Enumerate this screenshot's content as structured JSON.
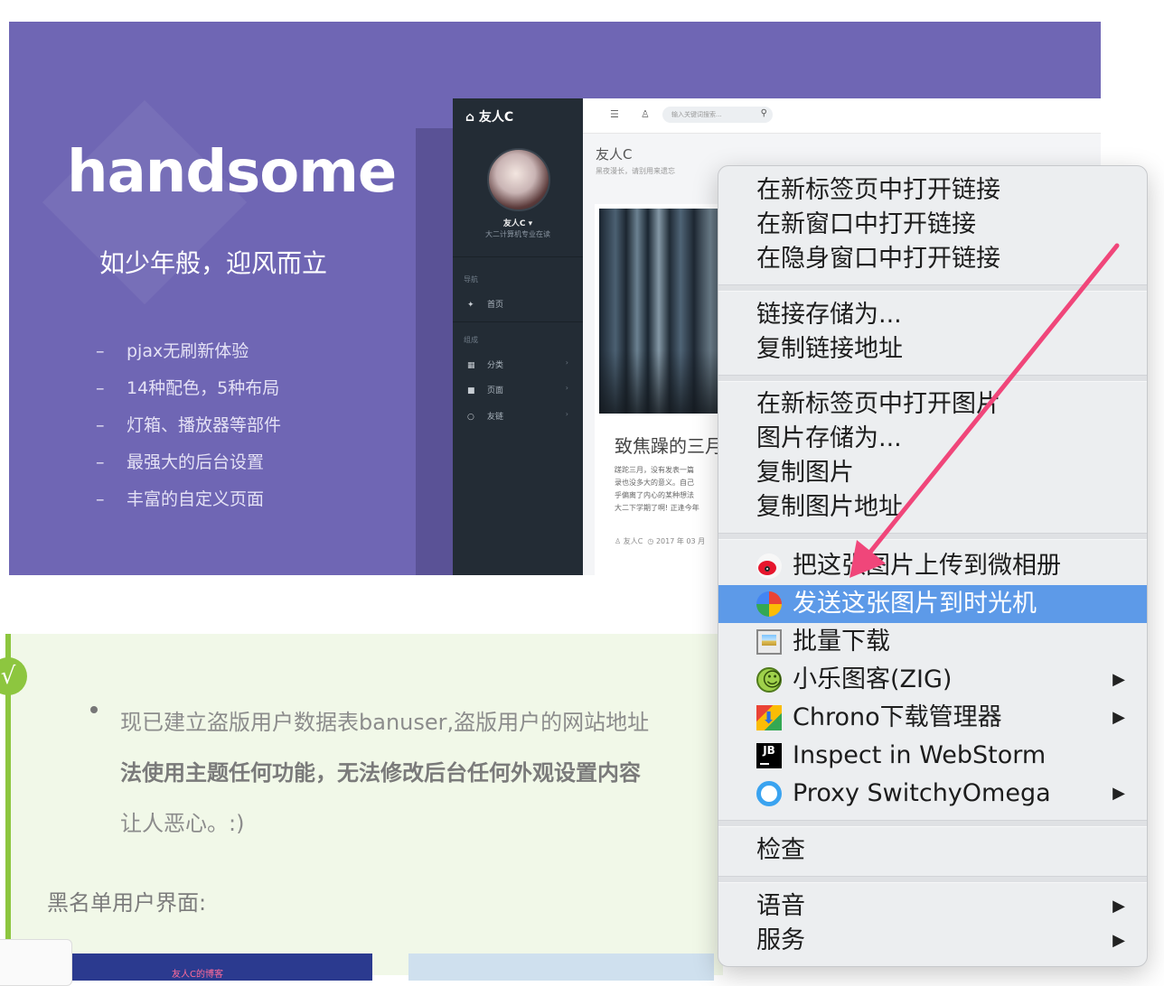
{
  "banner": {
    "title": "handsome",
    "tagline": "如少年般，迎风而立",
    "features": [
      "pjax无刷新体验",
      "14种配色，5种布局",
      "灯箱、播放器等部件",
      "最强大的后台设置",
      "丰富的自定义页面"
    ],
    "dash": "–",
    "preview": {
      "brand": "友人C",
      "username": "友人C ▾",
      "user_desc": "大二计算机专业在读",
      "section_nav": "导航",
      "section_compose": "组成",
      "nav_items": [
        {
          "label": "首页",
          "icon": "home-icon"
        },
        {
          "label": "分类",
          "icon": "grid-icon"
        },
        {
          "label": "页面",
          "icon": "file-icon"
        },
        {
          "label": "友链",
          "icon": "circle-icon"
        }
      ],
      "search_placeholder": "输入关键词搜索...",
      "page_title": "友人C",
      "page_sub": "黑夜漫长，请别用来遗忘",
      "post_title": "致焦躁的三月",
      "post_excerpt": [
        "蹉跎三月，没有发表一篇",
        "录也没多大的意义。自己",
        "乎偏离了内心的某种想法",
        "大二下学期了啊! 正逢今年"
      ],
      "post_meta_author": "友人C",
      "post_meta_date": "2017 年 03 月"
    }
  },
  "article": {
    "check_symbol": "√",
    "bullet_lines": [
      "现已建立盗版用户数据表banuser,盗版用户的网站地址",
      "法使用主题任何功能，无法修改后台任何外观设置内容",
      "让人恶心。:)"
    ],
    "heading": "黑名单用户界面:",
    "thumb_text": "友人C的博客"
  },
  "context_menu": {
    "group1": [
      "在新标签页中打开链接",
      "在新窗口中打开链接",
      "在隐身窗口中打开链接"
    ],
    "group2": [
      "链接存储为...",
      "复制链接地址"
    ],
    "group3": [
      "在新标签页中打开图片",
      "图片存储为...",
      "复制图片",
      "复制图片地址"
    ],
    "group4": [
      {
        "label": "把这张图片上传到微相册",
        "icon": "weibo-icon",
        "submenu": false
      },
      {
        "label": "发送这张图片到时光机",
        "icon": "pinwheel-icon",
        "submenu": false,
        "highlighted": true
      },
      {
        "label": "批量下载",
        "icon": "batch-download-icon",
        "submenu": false
      },
      {
        "label": "小乐图客(ZIG)",
        "icon": "zig-icon",
        "submenu": true
      },
      {
        "label": "Chrono下载管理器",
        "icon": "chrono-icon",
        "submenu": true
      },
      {
        "label": "Inspect in WebStorm",
        "icon": "jetbrains-icon",
        "submenu": false
      },
      {
        "label": "Proxy SwitchyOmega",
        "icon": "proxy-icon",
        "submenu": true
      }
    ],
    "group5": [
      "检查"
    ],
    "group6": [
      {
        "label": "语音",
        "submenu": true
      },
      {
        "label": "服务",
        "submenu": true
      }
    ],
    "submenu_arrow": "▶",
    "highlight_color": "#5d9ae8",
    "annotation_arrow_color": "#f0467a"
  }
}
